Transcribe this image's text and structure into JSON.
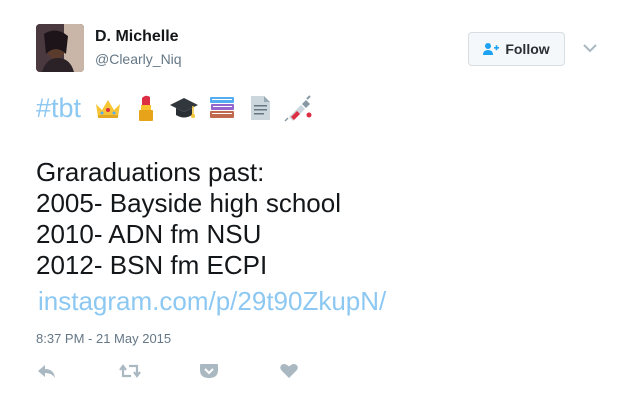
{
  "author": {
    "display_name": "D. Michelle",
    "handle": "@Clearly_Niq"
  },
  "follow_button": {
    "label": "Follow",
    "icon": "add-user-icon"
  },
  "tweet": {
    "hashtag": "#tbt",
    "emojis": [
      "crown-icon",
      "lipstick-icon",
      "graduation-cap-icon",
      "books-icon",
      "page-icon",
      "syringe-icon"
    ],
    "lines": [
      "Graraduations past:",
      "2005- Bayside high school",
      "2010- ADN fm NSU",
      "2012- BSN fm ECPI"
    ],
    "link": "instagram.com/p/29t90ZkupN/",
    "timestamp": "8:37 PM - 21 May 2015"
  },
  "actions": [
    "reply-icon",
    "retweet-icon",
    "pocket-icon",
    "like-heart-icon"
  ],
  "colors": {
    "link": "#8cc8f2",
    "muted": "#657786",
    "text": "#14171a",
    "action_icon": "#aab8c2"
  }
}
